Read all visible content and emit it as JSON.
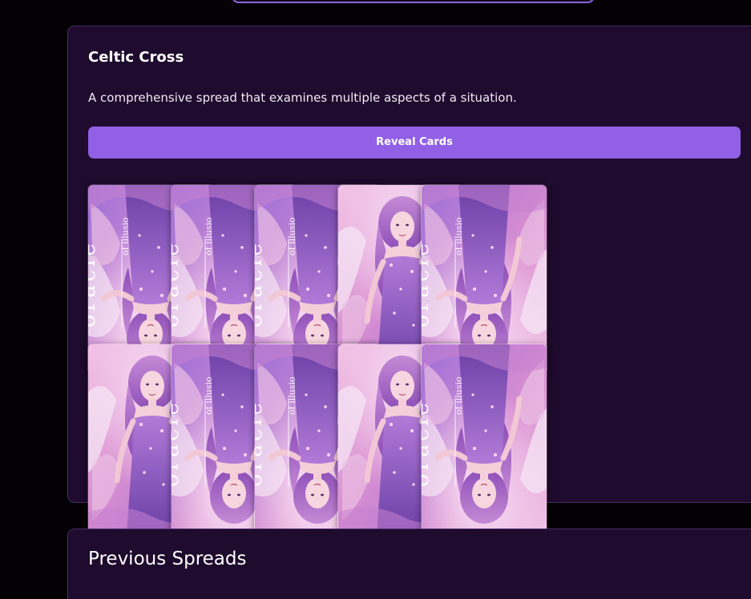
{
  "spread": {
    "title": "Celtic Cross",
    "description": "A comprehensive spread that examines multiple aspects of a situation.",
    "reveal_label": "Reveal Cards"
  },
  "card_text": {
    "deck_word": "oracle",
    "deck_subtitle": "of illusio"
  },
  "cards": [
    {
      "orientation": "reversed"
    },
    {
      "orientation": "reversed"
    },
    {
      "orientation": "reversed"
    },
    {
      "orientation": "upright"
    },
    {
      "orientation": "reversed"
    },
    {
      "orientation": "upright"
    },
    {
      "orientation": "reversed"
    },
    {
      "orientation": "reversed"
    },
    {
      "orientation": "upright"
    },
    {
      "orientation": "reversed"
    }
  ],
  "history": {
    "title": "Previous Spreads"
  }
}
